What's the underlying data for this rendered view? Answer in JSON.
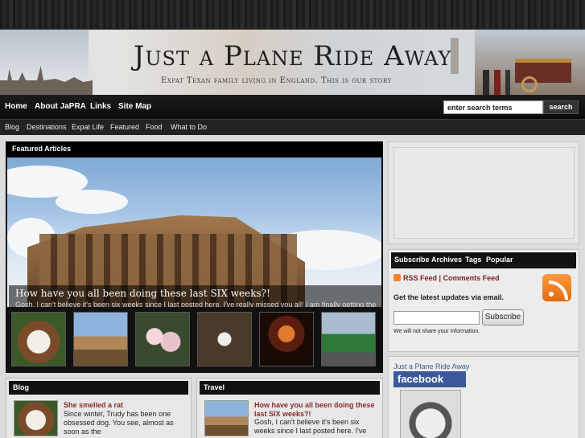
{
  "site": {
    "title": "Just a Plane Ride Away",
    "subtitle": "Expat Texan family living in England. This is our story"
  },
  "main_nav": [
    "Home",
    "About JaPRA",
    "Links",
    "Site Map"
  ],
  "search": {
    "value": "enter search terms",
    "button": "search"
  },
  "sub_nav": [
    "Blog",
    "Destinations",
    "Expat Life",
    "Featured",
    "Food",
    "What to Do"
  ],
  "featured": {
    "heading": "Featured Articles",
    "title": "How have you all been doing these last SIX weeks?!",
    "excerpt": "Gosh, I can't believe it's been six weeks since I last posted here. I've really missed you all! I am finally getting the hang of things with my online school! Plus we're finally done with some of the harder things in music business"
  },
  "blog": {
    "heading": "Blog",
    "post_title": "She smelled a rat",
    "post_text": "Since winter, Trudy has been one obsessed dog. You see, almost as soon as the"
  },
  "travel": {
    "heading": "Travel",
    "post_title": "How have you all been doing these last SIX weeks?!",
    "post_text": "Gosh, I can't believe it's been six weeks since I last posted here. I've"
  },
  "subscribe": {
    "tabs": [
      "Subscribe",
      "Archives",
      "Tags",
      "Popular"
    ],
    "rss_feed": "RSS Feed",
    "separator": "|",
    "comments_feed": "Comments Feed",
    "latest": "Get the latest updates via email.",
    "button": "Subscribe",
    "note": "We will not share your information."
  },
  "facebook": {
    "title": "Just a Plane Ride Away",
    "logo": "facebook"
  },
  "colors": {
    "accent": "#8a2a2a",
    "nav_bg": "#111111",
    "facebook": "#3b5998",
    "rss": "#f78422"
  }
}
